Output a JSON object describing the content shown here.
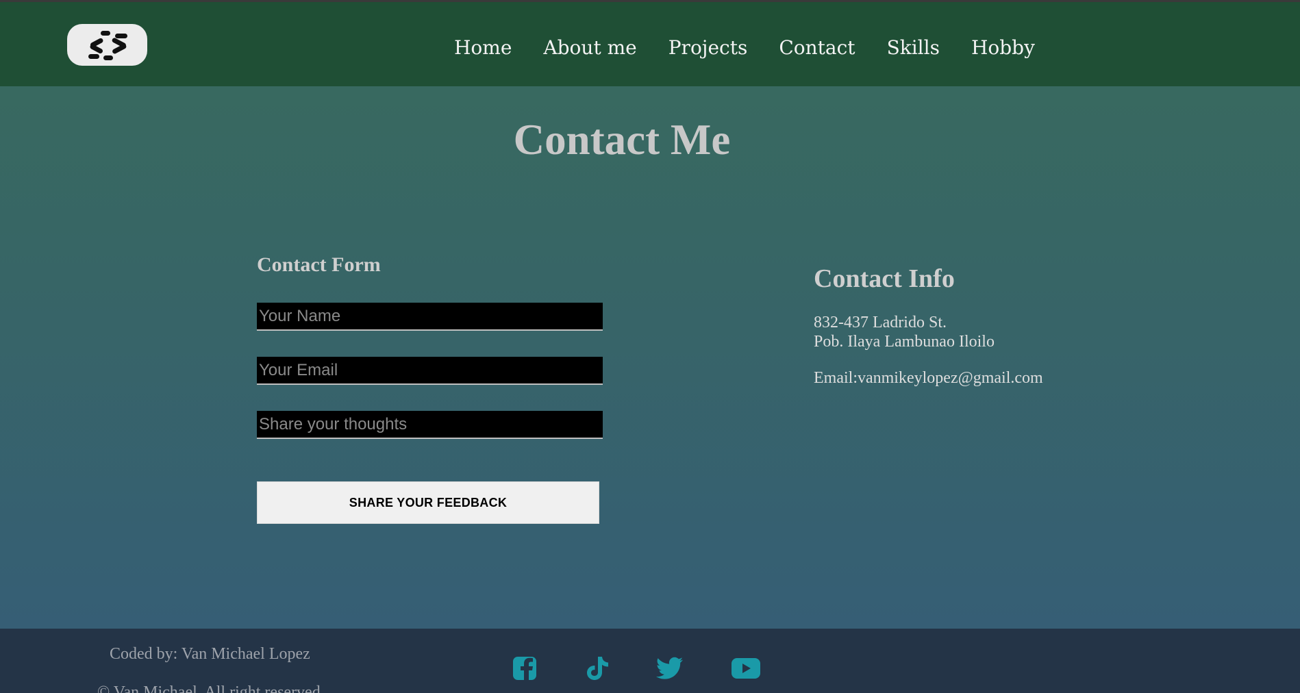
{
  "nav": {
    "items": [
      "Home",
      "About me",
      "Projects",
      "Contact",
      "Skills",
      "Hobby"
    ]
  },
  "page": {
    "title": "Contact Me"
  },
  "form": {
    "title": "Contact Form",
    "name_placeholder": "Your Name",
    "email_placeholder": "Your Email",
    "thoughts_placeholder": "Share your thoughts",
    "submit_label": "SHARE YOUR FEEDBACK"
  },
  "info": {
    "title": "Contact Info",
    "address_line1": "832-437 Ladrido St.",
    "address_line2": "Pob. Ilaya Lambunao Iloilo",
    "email": "Email:vanmikeylopez@gmail.com"
  },
  "footer": {
    "credit": "Coded by: Van Michael Lopez",
    "copyright": "© Van Michael. All right reserved",
    "social_icons": [
      "facebook-icon",
      "tiktok-icon",
      "twitter-icon",
      "youtube-icon"
    ],
    "icon_color": "#1a9aa8"
  },
  "colors": {
    "header_bg": "#1f4f35",
    "footer_bg": "#243447",
    "heading": "#c8c8c8"
  }
}
